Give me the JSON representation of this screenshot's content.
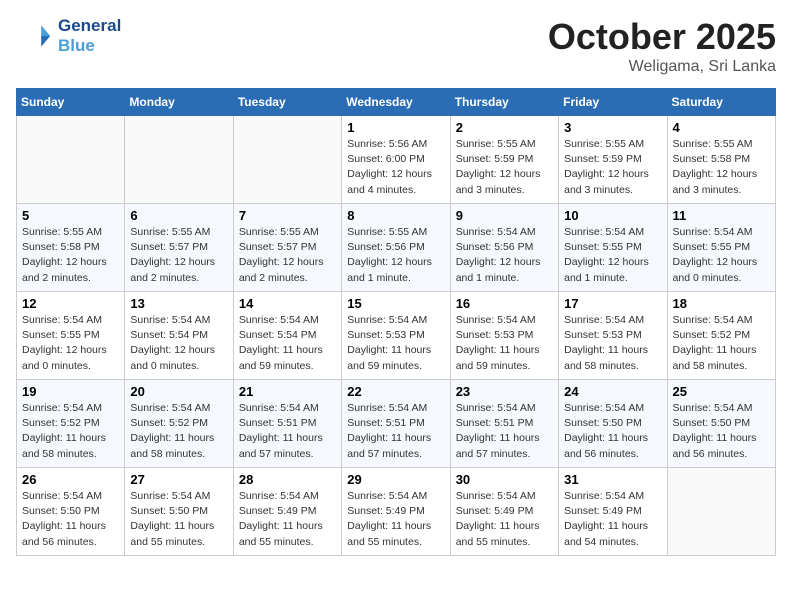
{
  "header": {
    "logo_line1": "General",
    "logo_line2": "Blue",
    "month": "October 2025",
    "location": "Weligama, Sri Lanka"
  },
  "weekdays": [
    "Sunday",
    "Monday",
    "Tuesday",
    "Wednesday",
    "Thursday",
    "Friday",
    "Saturday"
  ],
  "weeks": [
    [
      {
        "day": "",
        "info": ""
      },
      {
        "day": "",
        "info": ""
      },
      {
        "day": "",
        "info": ""
      },
      {
        "day": "1",
        "info": "Sunrise: 5:56 AM\nSunset: 6:00 PM\nDaylight: 12 hours\nand 4 minutes."
      },
      {
        "day": "2",
        "info": "Sunrise: 5:55 AM\nSunset: 5:59 PM\nDaylight: 12 hours\nand 3 minutes."
      },
      {
        "day": "3",
        "info": "Sunrise: 5:55 AM\nSunset: 5:59 PM\nDaylight: 12 hours\nand 3 minutes."
      },
      {
        "day": "4",
        "info": "Sunrise: 5:55 AM\nSunset: 5:58 PM\nDaylight: 12 hours\nand 3 minutes."
      }
    ],
    [
      {
        "day": "5",
        "info": "Sunrise: 5:55 AM\nSunset: 5:58 PM\nDaylight: 12 hours\nand 2 minutes."
      },
      {
        "day": "6",
        "info": "Sunrise: 5:55 AM\nSunset: 5:57 PM\nDaylight: 12 hours\nand 2 minutes."
      },
      {
        "day": "7",
        "info": "Sunrise: 5:55 AM\nSunset: 5:57 PM\nDaylight: 12 hours\nand 2 minutes."
      },
      {
        "day": "8",
        "info": "Sunrise: 5:55 AM\nSunset: 5:56 PM\nDaylight: 12 hours\nand 1 minute."
      },
      {
        "day": "9",
        "info": "Sunrise: 5:54 AM\nSunset: 5:56 PM\nDaylight: 12 hours\nand 1 minute."
      },
      {
        "day": "10",
        "info": "Sunrise: 5:54 AM\nSunset: 5:55 PM\nDaylight: 12 hours\nand 1 minute."
      },
      {
        "day": "11",
        "info": "Sunrise: 5:54 AM\nSunset: 5:55 PM\nDaylight: 12 hours\nand 0 minutes."
      }
    ],
    [
      {
        "day": "12",
        "info": "Sunrise: 5:54 AM\nSunset: 5:55 PM\nDaylight: 12 hours\nand 0 minutes."
      },
      {
        "day": "13",
        "info": "Sunrise: 5:54 AM\nSunset: 5:54 PM\nDaylight: 12 hours\nand 0 minutes."
      },
      {
        "day": "14",
        "info": "Sunrise: 5:54 AM\nSunset: 5:54 PM\nDaylight: 11 hours\nand 59 minutes."
      },
      {
        "day": "15",
        "info": "Sunrise: 5:54 AM\nSunset: 5:53 PM\nDaylight: 11 hours\nand 59 minutes."
      },
      {
        "day": "16",
        "info": "Sunrise: 5:54 AM\nSunset: 5:53 PM\nDaylight: 11 hours\nand 59 minutes."
      },
      {
        "day": "17",
        "info": "Sunrise: 5:54 AM\nSunset: 5:53 PM\nDaylight: 11 hours\nand 58 minutes."
      },
      {
        "day": "18",
        "info": "Sunrise: 5:54 AM\nSunset: 5:52 PM\nDaylight: 11 hours\nand 58 minutes."
      }
    ],
    [
      {
        "day": "19",
        "info": "Sunrise: 5:54 AM\nSunset: 5:52 PM\nDaylight: 11 hours\nand 58 minutes."
      },
      {
        "day": "20",
        "info": "Sunrise: 5:54 AM\nSunset: 5:52 PM\nDaylight: 11 hours\nand 58 minutes."
      },
      {
        "day": "21",
        "info": "Sunrise: 5:54 AM\nSunset: 5:51 PM\nDaylight: 11 hours\nand 57 minutes."
      },
      {
        "day": "22",
        "info": "Sunrise: 5:54 AM\nSunset: 5:51 PM\nDaylight: 11 hours\nand 57 minutes."
      },
      {
        "day": "23",
        "info": "Sunrise: 5:54 AM\nSunset: 5:51 PM\nDaylight: 11 hours\nand 57 minutes."
      },
      {
        "day": "24",
        "info": "Sunrise: 5:54 AM\nSunset: 5:50 PM\nDaylight: 11 hours\nand 56 minutes."
      },
      {
        "day": "25",
        "info": "Sunrise: 5:54 AM\nSunset: 5:50 PM\nDaylight: 11 hours\nand 56 minutes."
      }
    ],
    [
      {
        "day": "26",
        "info": "Sunrise: 5:54 AM\nSunset: 5:50 PM\nDaylight: 11 hours\nand 56 minutes."
      },
      {
        "day": "27",
        "info": "Sunrise: 5:54 AM\nSunset: 5:50 PM\nDaylight: 11 hours\nand 55 minutes."
      },
      {
        "day": "28",
        "info": "Sunrise: 5:54 AM\nSunset: 5:49 PM\nDaylight: 11 hours\nand 55 minutes."
      },
      {
        "day": "29",
        "info": "Sunrise: 5:54 AM\nSunset: 5:49 PM\nDaylight: 11 hours\nand 55 minutes."
      },
      {
        "day": "30",
        "info": "Sunrise: 5:54 AM\nSunset: 5:49 PM\nDaylight: 11 hours\nand 55 minutes."
      },
      {
        "day": "31",
        "info": "Sunrise: 5:54 AM\nSunset: 5:49 PM\nDaylight: 11 hours\nand 54 minutes."
      },
      {
        "day": "",
        "info": ""
      }
    ]
  ]
}
